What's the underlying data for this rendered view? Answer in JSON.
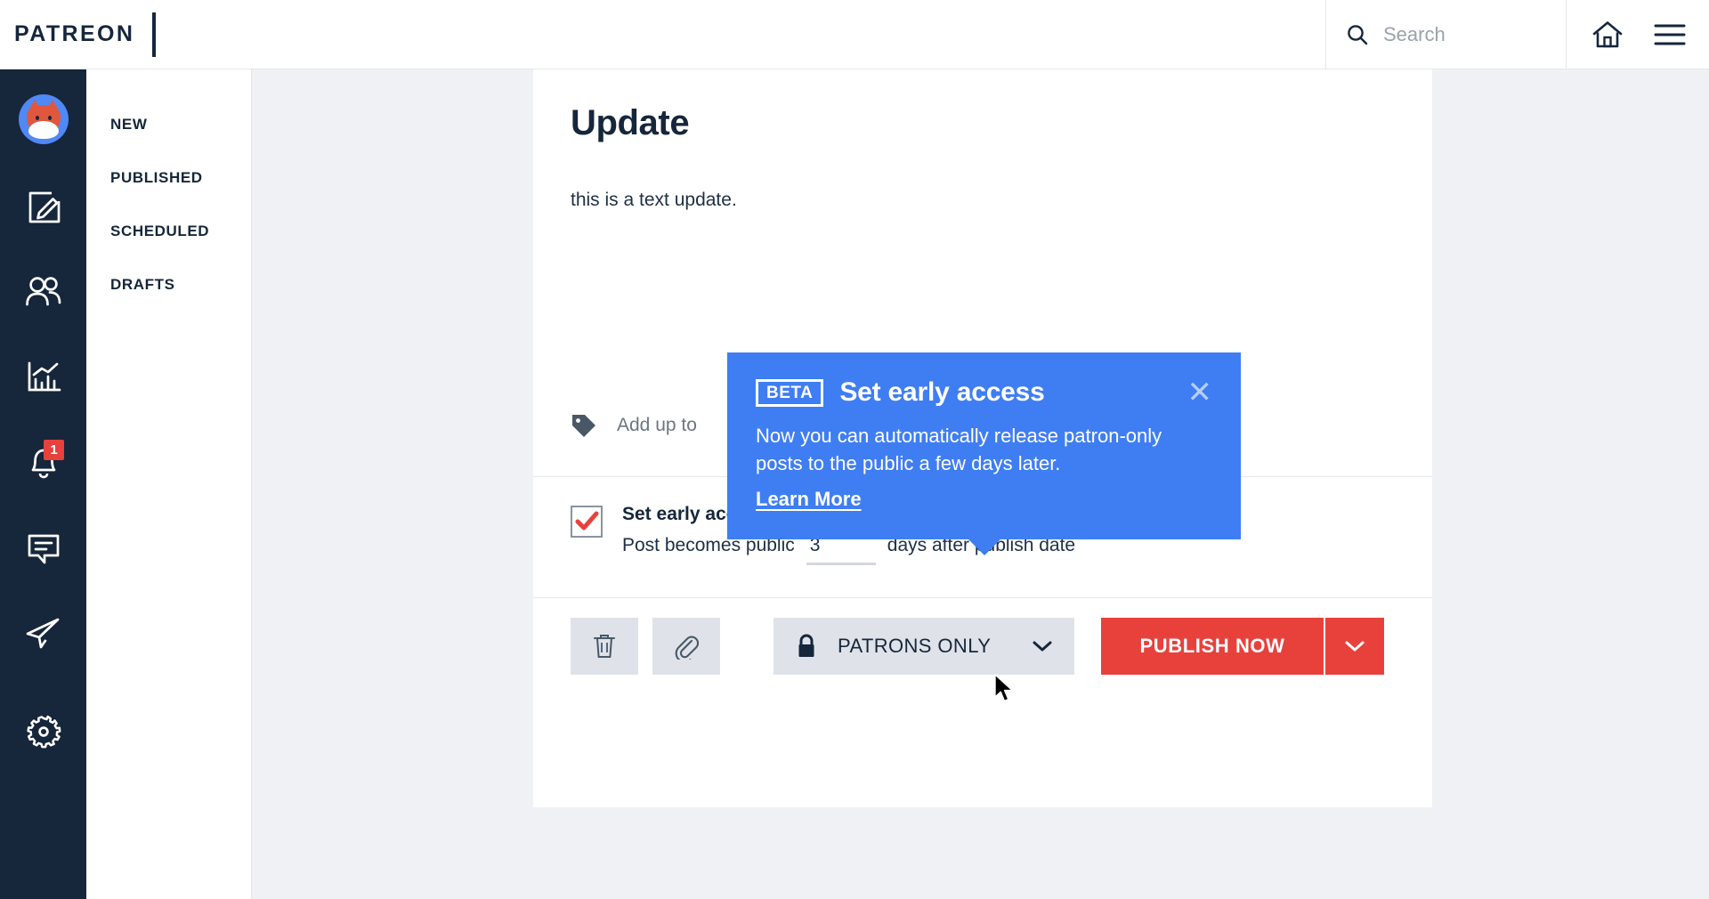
{
  "header": {
    "brand": "PATREON",
    "search": {
      "placeholder": "Search",
      "value": "",
      "icon": "search-icon"
    },
    "home_icon": "home-icon",
    "menu_icon": "hamburger-menu-icon"
  },
  "rail": {
    "avatar": "creator-avatar",
    "items": [
      {
        "icon": "compose-post-icon",
        "name": "compose"
      },
      {
        "icon": "patrons-people-icon",
        "name": "patrons"
      },
      {
        "icon": "insights-chart-icon",
        "name": "insights"
      },
      {
        "icon": "notifications-bell-icon",
        "name": "notifications",
        "badge": "1"
      },
      {
        "icon": "messages-chat-icon",
        "name": "messages"
      },
      {
        "icon": "send-paper-plane-icon",
        "name": "send"
      },
      {
        "icon": "settings-gear-icon",
        "name": "settings"
      }
    ]
  },
  "subnav": {
    "items": [
      {
        "label": "NEW"
      },
      {
        "label": "PUBLISHED"
      },
      {
        "label": "SCHEDULED"
      },
      {
        "label": "DRAFTS"
      }
    ]
  },
  "editor": {
    "title": "Update",
    "body": "this is a text update.",
    "tag_row": {
      "icon": "tag-icon",
      "label": "Add up to"
    },
    "early_access": {
      "checkbox_checked": true,
      "label": "Set early access",
      "prefix": "Post becomes public",
      "days_value": "3",
      "suffix": "days after publish date"
    },
    "toolbar": {
      "delete_icon": "trash-icon",
      "attach_icon": "paperclip-icon",
      "visibility": {
        "icon": "lock-icon",
        "label": "PATRONS ONLY",
        "caret": "chevron-down-icon"
      },
      "publish_label": "PUBLISH NOW",
      "publish_caret": "chevron-down-icon"
    }
  },
  "tooltip": {
    "beta_badge": "BETA",
    "title": "Set early access",
    "body": "Now you can automatically release patron-only posts to the public a few days later.",
    "link": "Learn More",
    "close_icon": "close-x-icon"
  },
  "colors": {
    "navy": "#16263b",
    "accent_red": "#e8413c",
    "tooltip_blue": "#3f7ef2",
    "page_bg": "#eff1f4"
  }
}
